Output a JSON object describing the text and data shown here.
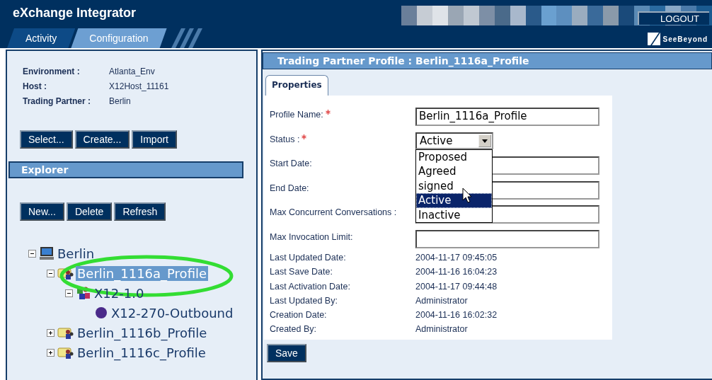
{
  "app": {
    "title": "eXchange Integrator",
    "logout": "LOGOUT",
    "brand": "SeeBeyond"
  },
  "tabs": [
    {
      "label": "Activity",
      "selected": false
    },
    {
      "label": "Configuration",
      "selected": true
    }
  ],
  "context": [
    {
      "label": "Environment :",
      "value": "Atlanta_Env"
    },
    {
      "label": "Host :",
      "value": "X12Host_11161"
    },
    {
      "label": "Trading Partner :",
      "value": "Berlin"
    }
  ],
  "context_buttons": [
    "Select...",
    "Create...",
    "Import"
  ],
  "explorer": {
    "title": "Explorer",
    "buttons": [
      "New...",
      "Delete",
      "Refresh"
    ],
    "tree": [
      {
        "label": "Berlin",
        "kind": "partner",
        "expanded": true,
        "selected": false,
        "children": [
          {
            "label": "Berlin_1116a_Profile",
            "kind": "profile",
            "expanded": true,
            "selected": true,
            "children": [
              {
                "label": "X12-1.0",
                "kind": "protocol",
                "expanded": true,
                "selected": false,
                "children": [
                  {
                    "label": "X12-270-Outbound",
                    "kind": "transaction",
                    "selected": false
                  }
                ]
              }
            ]
          },
          {
            "label": "Berlin_1116b_Profile",
            "kind": "profile",
            "expanded": false,
            "selected": false
          },
          {
            "label": "Berlin_1116c_Profile",
            "kind": "profile",
            "expanded": false,
            "selected": false
          }
        ]
      }
    ]
  },
  "profile": {
    "title": "Trading Partner Profile :  Berlin_1116a_Profile",
    "tabs": [
      {
        "label": "Properties",
        "selected": true
      }
    ],
    "fields": [
      {
        "kind": "text",
        "label": "Profile Name:",
        "required": true,
        "value": "Berlin_1116a_Profile"
      },
      {
        "kind": "select",
        "label": "Status :",
        "required": true,
        "value": "Active",
        "open": true,
        "options": [
          {
            "label": "Proposed",
            "selected": false
          },
          {
            "label": "Agreed",
            "selected": false
          },
          {
            "label": "signed",
            "selected": false
          },
          {
            "label": "Active",
            "selected": true
          },
          {
            "label": "Inactive",
            "selected": false
          }
        ]
      },
      {
        "kind": "text",
        "label": "Start Date:",
        "required": false
      },
      {
        "kind": "text",
        "label": "End Date:",
        "required": false
      },
      {
        "kind": "text",
        "label": "Max Concurrent Conversations :",
        "required": false
      },
      {
        "kind": "text",
        "label": "Max Invocation Limit:",
        "required": false
      },
      {
        "kind": "info",
        "label": "Last Updated Date:",
        "value": "2004-11-17 09:45:05"
      },
      {
        "kind": "info",
        "label": "Last Save Date:",
        "value": "2004-11-16 16:04:23"
      },
      {
        "kind": "info",
        "label": "Last Activation Date:",
        "value": "2004-11-17 09:44:48"
      },
      {
        "kind": "info",
        "label": "Last Updated By:",
        "value": "Administrator"
      },
      {
        "kind": "info",
        "label": "Creation Date:",
        "value": "2004-11-16 16:02:32"
      },
      {
        "kind": "info",
        "label": "Created By:",
        "value": "Administrator"
      }
    ],
    "save": "Save"
  }
}
